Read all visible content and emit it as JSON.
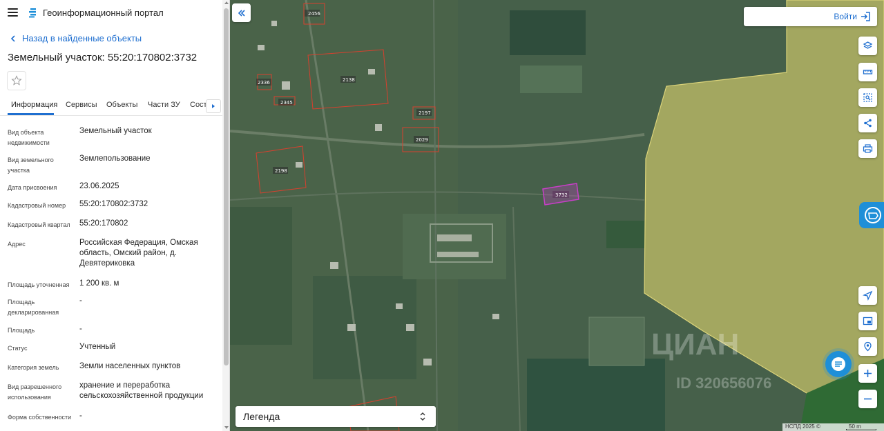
{
  "header": {
    "portal_title": "Геоинформационный портал"
  },
  "nav": {
    "back_label": "Назад в найденные объекты"
  },
  "object": {
    "title": "Земельный участок: 55:20:170802:3732"
  },
  "tabs": [
    {
      "label": "Информация",
      "active": true
    },
    {
      "label": "Сервисы"
    },
    {
      "label": "Объекты"
    },
    {
      "label": "Части ЗУ"
    },
    {
      "label": "Состав"
    }
  ],
  "properties": [
    {
      "label": "Вид объекта недвижимости",
      "value": "Земельный участок"
    },
    {
      "label": "Вид земельного участка",
      "value": "Землепользование"
    },
    {
      "label": "Дата присвоения",
      "value": "23.06.2025"
    },
    {
      "label": "Кадастровый номер",
      "value": "55:20:170802:3732"
    },
    {
      "label": "Кадастровый квартал",
      "value": "55:20:170802"
    },
    {
      "label": "Адрес",
      "value": "Российская Федерация, Омская область, Омский район, д. Девятериковка"
    },
    {
      "label": "Площадь уточненная",
      "value": "1 200 кв. м"
    },
    {
      "label": "Площадь декларированная",
      "value": "-"
    },
    {
      "label": "Площадь",
      "value": "-"
    },
    {
      "label": "Статус",
      "value": "Учтенный"
    },
    {
      "label": "Категория земель",
      "value": "Земли населенных пунктов"
    },
    {
      "label": "Вид разрешенного использования",
      "value": "хранение и переработка сельскохозяйственной продукции"
    },
    {
      "label": "Форма собственности",
      "value": "-"
    }
  ],
  "map": {
    "login_label": "Войти",
    "legend_label": "Легенда",
    "attribution": "НСПД 2025 ©",
    "scale_label": "50 m",
    "watermark_brand": "ЦИАН",
    "watermark_id": "ID 320656076",
    "parcels": [
      "2456",
      "2138",
      "2336",
      "2345",
      "2197",
      "2029",
      "2198",
      "3732"
    ],
    "colors": {
      "selected_parcel": "#c83fc8",
      "parcel": "#d8402e",
      "zone_fill": "#c8c26a",
      "accent": "#1f6fd0"
    },
    "tools": [
      "layers-icon",
      "ruler-icon",
      "select-area-icon",
      "share-icon",
      "print-icon",
      "locate-icon",
      "minimap-icon",
      "geo-search-icon",
      "zoom-in-icon",
      "zoom-out-icon"
    ]
  }
}
